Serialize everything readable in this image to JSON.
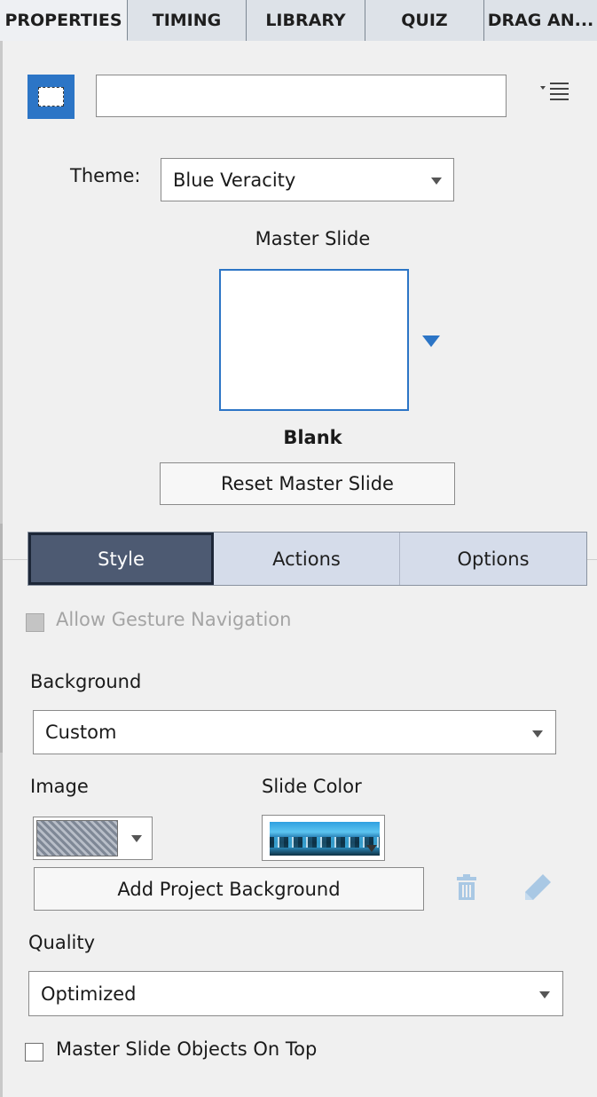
{
  "tabs": [
    {
      "label": "PROPERTIES",
      "active": true
    },
    {
      "label": "TIMING",
      "active": false
    },
    {
      "label": "LIBRARY",
      "active": false
    },
    {
      "label": "QUIZ",
      "active": false
    },
    {
      "label": "DRAG AN...",
      "active": false
    }
  ],
  "header": {
    "name_value": "",
    "menu_icon": "list-menu-icon"
  },
  "theme": {
    "label": "Theme:",
    "value": "Blue Veracity"
  },
  "master_slide": {
    "label": "Master Slide",
    "name": "Blank",
    "reset_label": "Reset Master Slide"
  },
  "segments": [
    {
      "label": "Style",
      "active": true
    },
    {
      "label": "Actions",
      "active": false
    },
    {
      "label": "Options",
      "active": false
    }
  ],
  "gesture": {
    "label": "Allow Gesture Navigation",
    "checked": false,
    "disabled": true
  },
  "background": {
    "label": "Background",
    "value": "Custom"
  },
  "image": {
    "label": "Image"
  },
  "slide_color": {
    "label": "Slide Color"
  },
  "add_background": {
    "label": "Add Project Background"
  },
  "quality": {
    "label": "Quality",
    "value": "Optimized"
  },
  "master_objects": {
    "label": "Master Slide Objects On Top",
    "checked": false
  },
  "colors": {
    "accent": "#2c75c6",
    "active_segment": "#4d5a72",
    "panel": "#f0f0f0"
  }
}
